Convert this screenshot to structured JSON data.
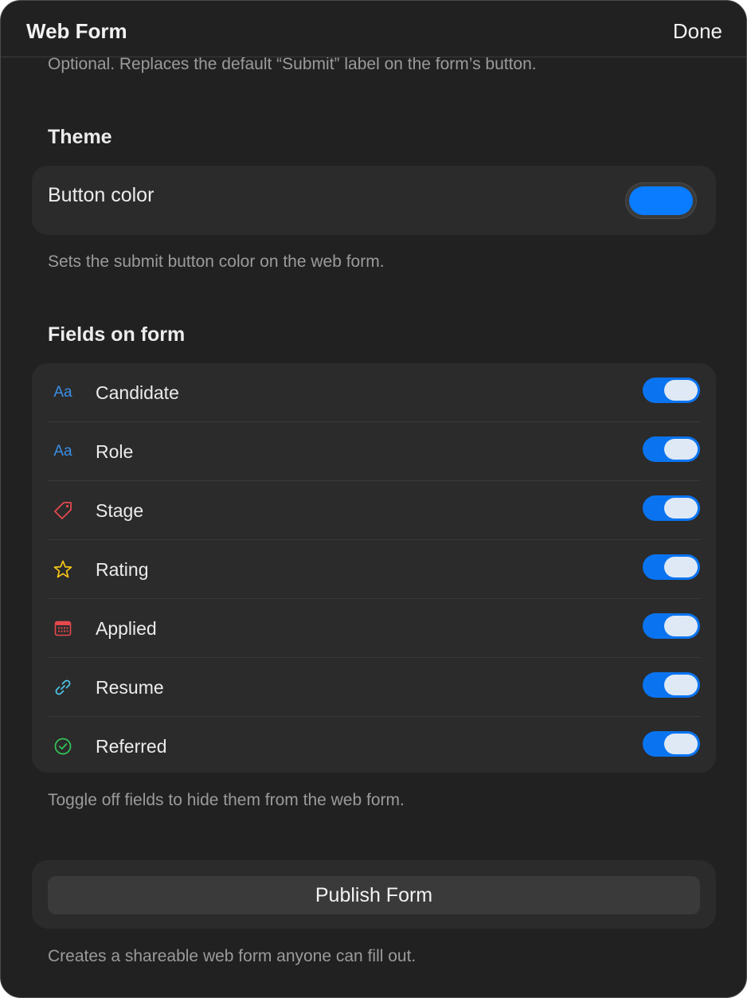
{
  "header": {
    "title": "Web Form",
    "done_label": "Done"
  },
  "submit_label_hint": "Optional. Replaces the default “Submit” label on the form’s button.",
  "theme": {
    "heading": "Theme",
    "button_color_label": "Button color",
    "button_color_value": "#0a7cff",
    "caption": "Sets the submit button color on the web form."
  },
  "fields": {
    "heading": "Fields on form",
    "items": [
      {
        "label": "Candidate",
        "icon": "text-aa-icon",
        "enabled": true
      },
      {
        "label": "Role",
        "icon": "text-aa-icon",
        "enabled": true
      },
      {
        "label": "Stage",
        "icon": "tag-icon",
        "enabled": true
      },
      {
        "label": "Rating",
        "icon": "star-icon",
        "enabled": true
      },
      {
        "label": "Applied",
        "icon": "calendar-icon",
        "enabled": true
      },
      {
        "label": "Resume",
        "icon": "link-icon",
        "enabled": true
      },
      {
        "label": "Referred",
        "icon": "checkmark-circle-icon",
        "enabled": true
      }
    ],
    "caption": "Toggle off fields to hide them from the web form."
  },
  "publish": {
    "button_label": "Publish Form",
    "caption": "Creates a shareable web form anyone can fill out."
  },
  "colors": {
    "accent": "#0a7cff",
    "text_icon": "#3a8ee6",
    "tag_icon": "#e5484d",
    "star_icon": "#f5c518",
    "calendar_icon": "#e5484d",
    "link_icon": "#4cc3e6",
    "check_icon": "#34c759"
  }
}
